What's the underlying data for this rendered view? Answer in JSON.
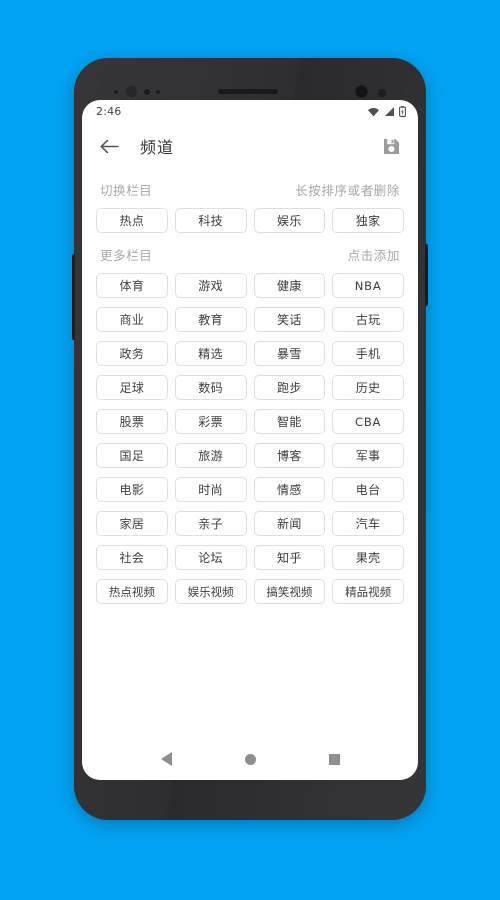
{
  "theme": {
    "page_background": "#03A3F4",
    "screen_background": "#FFFFFF",
    "chip_border": "#DFDFDF",
    "chip_text": "#3A3A3A",
    "muted_text": "#A6A6A6"
  },
  "status_bar": {
    "time": "2:46",
    "icons": [
      "wifi-icon",
      "signal-icon",
      "battery-icon"
    ]
  },
  "app_bar": {
    "back_icon": "arrow-left-icon",
    "title": "频道",
    "save_icon": "save-floppy-icon"
  },
  "sections": [
    {
      "id": "selected",
      "title": "切换栏目",
      "hint": "长按排序或者删除",
      "chips": [
        "热点",
        "科技",
        "娱乐",
        "独家"
      ]
    },
    {
      "id": "more",
      "title": "更多栏目",
      "hint": "点击添加",
      "chips": [
        "体育",
        "游戏",
        "健康",
        "NBA",
        "商业",
        "教育",
        "笑话",
        "古玩",
        "政务",
        "精选",
        "暴雪",
        "手机",
        "足球",
        "数码",
        "跑步",
        "历史",
        "股票",
        "彩票",
        "智能",
        "CBA",
        "国足",
        "旅游",
        "博客",
        "军事",
        "电影",
        "时尚",
        "情感",
        "电台",
        "家居",
        "亲子",
        "新闻",
        "汽车",
        "社会",
        "论坛",
        "知乎",
        "果壳",
        "热点视频",
        "娱乐视频",
        "搞笑视频",
        "精品视频"
      ]
    }
  ],
  "nav_bar": {
    "back_label": "back-triangle-icon",
    "home_label": "home-circle-icon",
    "recents_label": "recents-square-icon"
  }
}
